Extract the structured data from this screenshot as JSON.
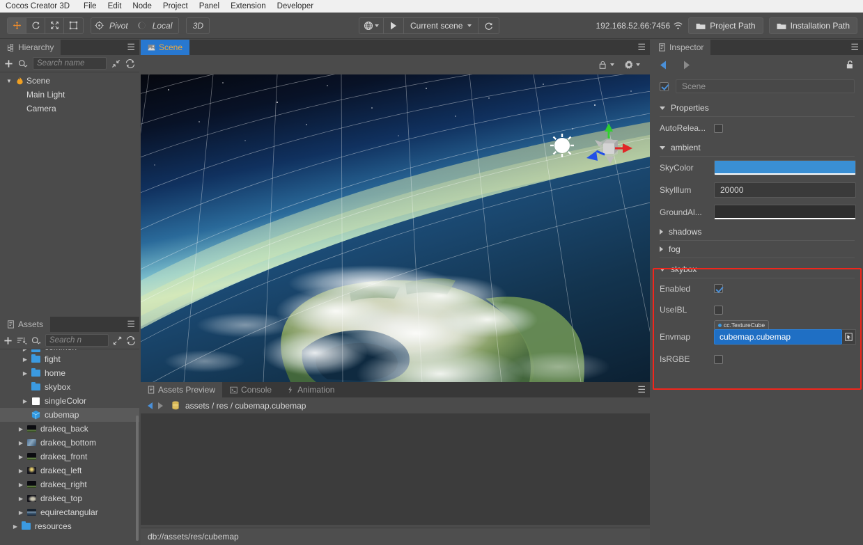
{
  "menubar": {
    "items": [
      {
        "label": "Cocos Creator 3D",
        "brand": true
      },
      {
        "label": "File"
      },
      {
        "label": "Edit"
      },
      {
        "label": "Node"
      },
      {
        "label": "Project"
      },
      {
        "label": "Panel"
      },
      {
        "label": "Extension"
      },
      {
        "label": "Developer"
      }
    ]
  },
  "toolbar": {
    "transform_tools": [
      {
        "name": "move-tool",
        "glyph": "✥",
        "active": true
      },
      {
        "name": "rotate-tool",
        "glyph": "↻",
        "active": false
      },
      {
        "name": "scale-tool",
        "glyph": "⤢",
        "active": false
      },
      {
        "name": "rect-tool",
        "glyph": "⬚",
        "active": false
      }
    ],
    "pivot_label": "Pivot",
    "coord_label": "Local",
    "dimension_label": "3D",
    "scene_selector_label": "Current scene",
    "ip_address": "192.168.52.66:7456",
    "project_path_label": "Project Path",
    "installation_path_label": "Installation Path"
  },
  "hierarchy": {
    "tab_label": "Hierarchy",
    "search_placeholder": "Search name",
    "nodes": [
      {
        "label": "Scene",
        "depth": 0,
        "expanded": true,
        "icon": "flame-icon",
        "selected": false
      },
      {
        "label": "Main Light",
        "depth": 1,
        "expanded": null,
        "icon": "none",
        "selected": false
      },
      {
        "label": "Camera",
        "depth": 1,
        "expanded": null,
        "icon": "none",
        "selected": false
      }
    ]
  },
  "assets": {
    "tab_label": "Assets",
    "search_placeholder": "Search n",
    "rows": [
      {
        "label": "common",
        "depth": 1,
        "icon": "folder",
        "arrow": true,
        "selected": false,
        "partial": true
      },
      {
        "label": "fight",
        "depth": 1,
        "icon": "folder",
        "arrow": true,
        "selected": false
      },
      {
        "label": "home",
        "depth": 1,
        "icon": "folder",
        "arrow": true,
        "selected": false
      },
      {
        "label": "skybox",
        "depth": 1,
        "icon": "folder",
        "arrow": false,
        "selected": false
      },
      {
        "label": "singleColor",
        "depth": 1,
        "icon": "white-swatch",
        "arrow": true,
        "selected": false
      },
      {
        "label": "cubemap",
        "depth": 2,
        "icon": "cube",
        "arrow": false,
        "selected": true
      },
      {
        "label": "drakeq_back",
        "depth": 1,
        "icon": "thumb-back",
        "arrow": true,
        "selected": false
      },
      {
        "label": "drakeq_bottom",
        "depth": 1,
        "icon": "thumb-bottom",
        "arrow": true,
        "selected": false
      },
      {
        "label": "drakeq_front",
        "depth": 1,
        "icon": "thumb-front",
        "arrow": true,
        "selected": false
      },
      {
        "label": "drakeq_left",
        "depth": 1,
        "icon": "thumb-left",
        "arrow": true,
        "selected": false
      },
      {
        "label": "drakeq_right",
        "depth": 1,
        "icon": "thumb-right",
        "arrow": true,
        "selected": false
      },
      {
        "label": "drakeq_top",
        "depth": 1,
        "icon": "thumb-top",
        "arrow": true,
        "selected": false
      },
      {
        "label": "equirectangular",
        "depth": 1,
        "icon": "thumb-equi",
        "arrow": true,
        "selected": false
      },
      {
        "label": "resources",
        "depth": 0,
        "icon": "folder",
        "arrow": true,
        "selected": false
      }
    ]
  },
  "scene": {
    "tab_label": "Scene"
  },
  "bottom_dock": {
    "tabs": [
      {
        "label": "Assets Preview",
        "active": true,
        "icon": "document-icon"
      },
      {
        "label": "Console",
        "active": false,
        "icon": "terminal-icon"
      },
      {
        "label": "Animation",
        "active": false,
        "icon": "key-icon"
      }
    ],
    "breadcrumb": "assets / res / cubemap.cubemap"
  },
  "statusbar": {
    "path": "db://assets/res/cubemap"
  },
  "inspector": {
    "tab_label": "Inspector",
    "node_name": "Scene",
    "node_enabled": true,
    "sections": [
      {
        "name": "Properties",
        "expanded": true,
        "rows": [
          {
            "label": "AutoRelea...",
            "type": "checkbox",
            "value": false
          }
        ]
      },
      {
        "name": "ambient",
        "expanded": true,
        "rows": [
          {
            "label": "SkyColor",
            "type": "color",
            "value": "#3a8fd4"
          },
          {
            "label": "SkyIllum",
            "type": "text",
            "value": "20000"
          },
          {
            "label": "GroundAl...",
            "type": "color",
            "value": "#2e2e2e"
          }
        ]
      },
      {
        "name": "shadows",
        "expanded": false,
        "rows": []
      },
      {
        "name": "fog",
        "expanded": false,
        "rows": []
      },
      {
        "name": "skybox",
        "expanded": true,
        "highlighted": true,
        "rows": [
          {
            "label": "Enabled",
            "type": "checkbox",
            "value": true
          },
          {
            "label": "UseIBL",
            "type": "checkbox",
            "value": false
          },
          {
            "label": "Envmap",
            "type": "asset",
            "value": "cubemap.cubemap",
            "tag": "cc.TextureCube"
          },
          {
            "label": "IsRGBE",
            "type": "checkbox",
            "value": false
          }
        ]
      }
    ]
  },
  "colors": {
    "accent_blue": "#2878d0",
    "highlight_red": "#f2261c",
    "panel_bg": "#4b4b4b",
    "tab_bg": "#383838",
    "folder_blue": "#3b9ae1",
    "orange": "#f08c2a"
  }
}
